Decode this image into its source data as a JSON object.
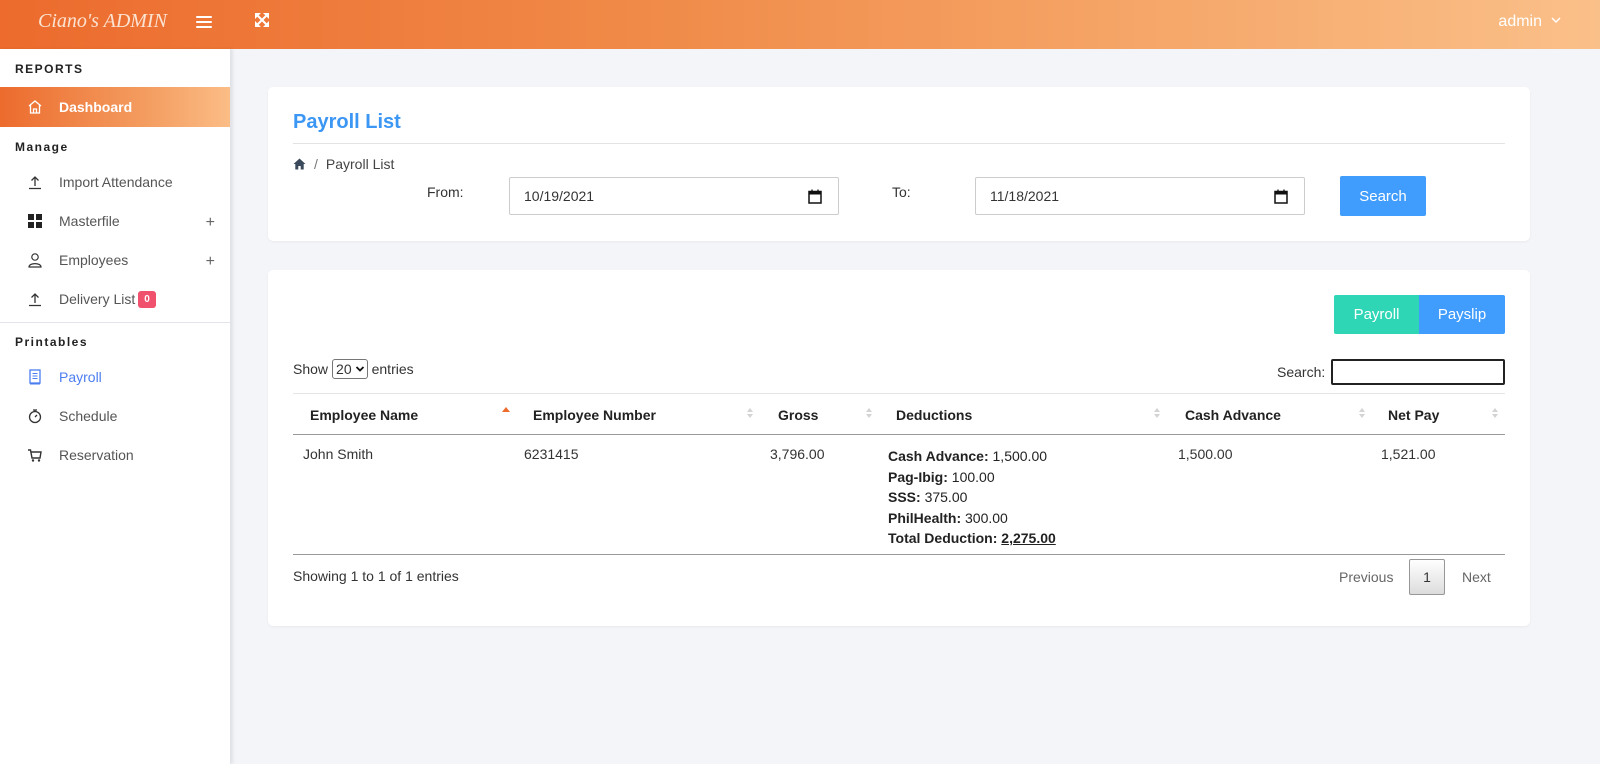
{
  "header": {
    "brand": "Ciano's ADMIN",
    "user": "admin",
    "icons": [
      "hamburger-icon",
      "expand-icon",
      "chevron-down-icon"
    ]
  },
  "sidebar": {
    "sections": {
      "reports": "REPORTS",
      "manage": "Manage",
      "printables": "Printables"
    },
    "items": [
      {
        "label": "Dashboard",
        "icon": "home-icon",
        "active": true
      },
      {
        "label": "Import Attendance",
        "icon": "upload-icon"
      },
      {
        "label": "Masterfile",
        "icon": "grid-icon",
        "expand": "+"
      },
      {
        "label": "Employees",
        "icon": "user-icon",
        "expand": "+"
      },
      {
        "label": "Delivery List",
        "icon": "upload-icon",
        "badge": "0"
      },
      {
        "label": "Payroll",
        "icon": "receipt-icon",
        "current": true
      },
      {
        "label": "Schedule",
        "icon": "stopwatch-icon"
      },
      {
        "label": "Reservation",
        "icon": "cart-icon"
      }
    ]
  },
  "page": {
    "title": "Payroll List",
    "breadcrumb": {
      "separator": "/",
      "current": "Payroll List"
    },
    "filter": {
      "from_label": "From:",
      "from_value": "10/19/2021",
      "to_label": "To:",
      "to_value": "11/18/2021",
      "search_button": "Search"
    }
  },
  "actions": {
    "payroll": "Payroll",
    "payslip": "Payslip"
  },
  "table": {
    "show_label": "Show",
    "entries_value": "20",
    "entries_label": "entries",
    "search_label": "Search:",
    "search_value": "",
    "columns": [
      "Employee Name",
      "Employee Number",
      "Gross",
      "Deductions",
      "Cash Advance",
      "Net Pay"
    ],
    "sorted_column": "Employee Name",
    "rows": [
      {
        "name": "John Smith",
        "number": "6231415",
        "gross": "3,796.00",
        "deductions": [
          {
            "label": "Cash Advance:",
            "value": "1,500.00"
          },
          {
            "label": "Pag-Ibig:",
            "value": "100.00"
          },
          {
            "label": "SSS:",
            "value": "375.00"
          },
          {
            "label": "PhilHealth:",
            "value": "300.00"
          },
          {
            "label": "Total Deduction:",
            "value": "2,275.00"
          }
        ],
        "cash_advance": "1,500.00",
        "net_pay": "1,521.00"
      }
    ],
    "info": "Showing 1 to 1 of 1 entries",
    "pagination": {
      "previous": "Previous",
      "current": "1",
      "next": "Next"
    }
  },
  "colors": {
    "accent": "#ec6b2d",
    "title_blue": "#3b96f4",
    "button_blue": "#409cfd",
    "button_teal": "#2fd6b6",
    "badge": "#f0516d",
    "sort_active": "#ec6b2d"
  }
}
